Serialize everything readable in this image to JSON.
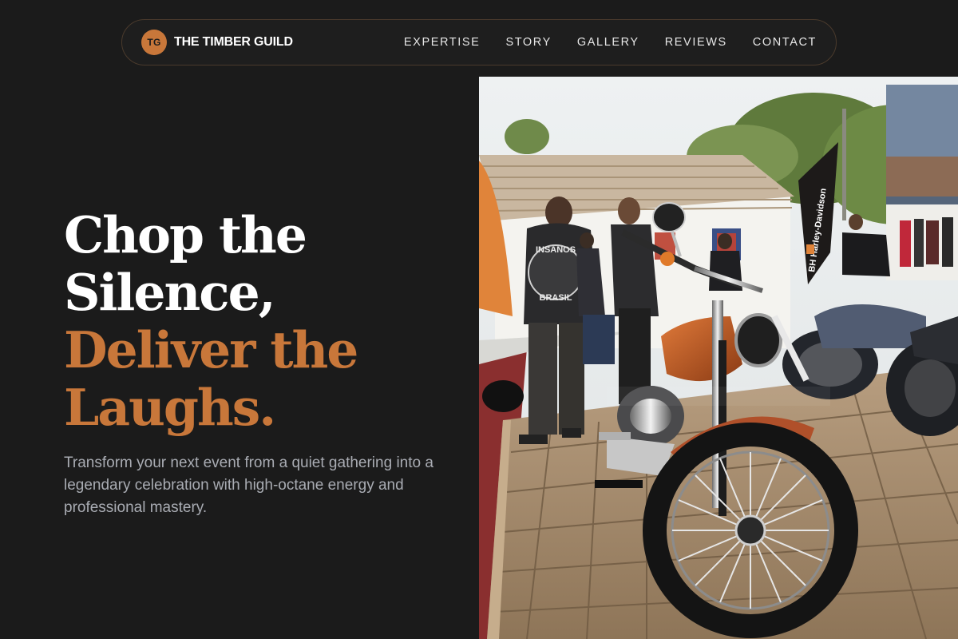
{
  "brand": {
    "initials": "TG",
    "name": "THE TIMBER GUILD"
  },
  "nav": {
    "items": [
      "EXPERTISE",
      "STORY",
      "GALLERY",
      "REVIEWS",
      "CONTACT"
    ]
  },
  "hero": {
    "line1": "Chop the",
    "line2": "Silence,",
    "line3": "Deliver the",
    "line4": "Laughs.",
    "subtitle": "Transform your next event from a quiet gathering into a legendary celebration with high-octane energy and professional mastery."
  },
  "photo": {
    "banner_text": "BH Harley-Davidson",
    "vest_top": "INSANOS",
    "vest_bottom": "BRASIL"
  },
  "colors": {
    "accent": "#c8773a",
    "background": "#1b1b1b",
    "text": "#ffffff",
    "muted": "#a9acb3"
  }
}
